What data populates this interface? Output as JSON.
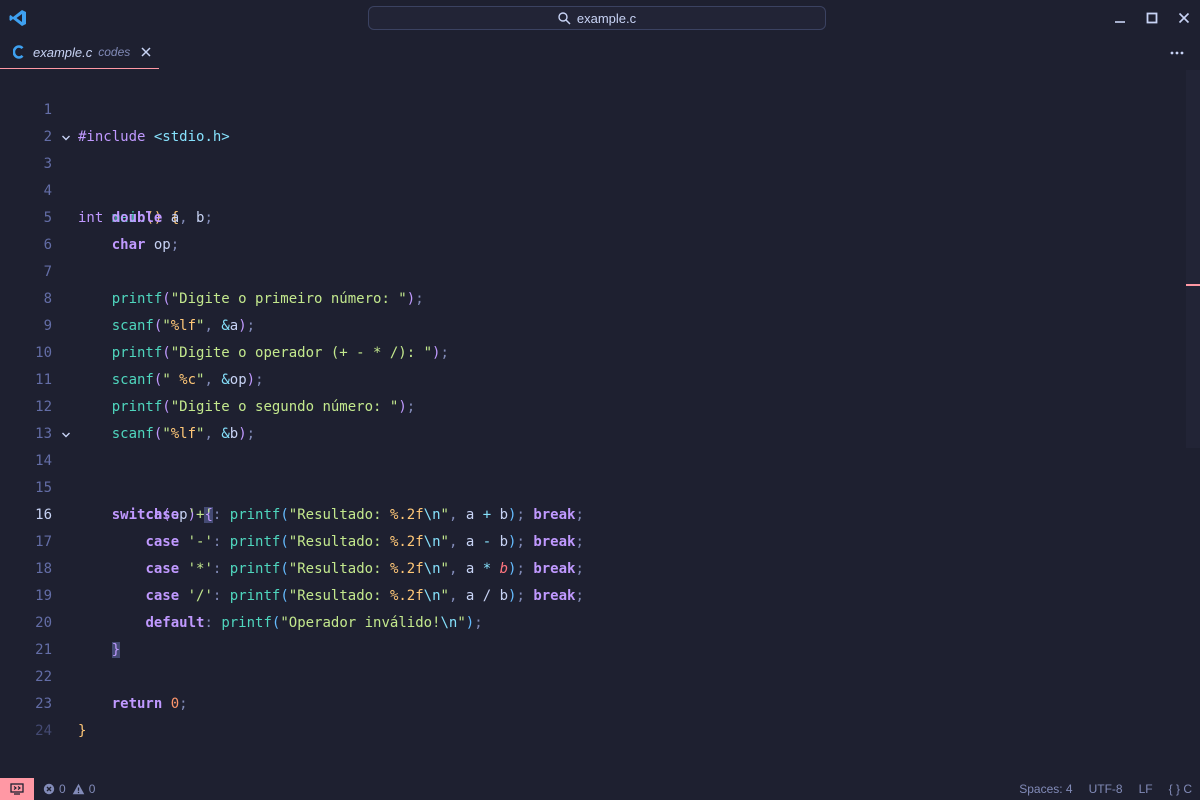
{
  "window": {
    "search_text": "example.c"
  },
  "tab": {
    "name": "example.c",
    "description": "codes"
  },
  "editor": {
    "active_line": 16,
    "line_numbers": [
      "1",
      "2",
      "3",
      "4",
      "5",
      "6",
      "7",
      "8",
      "9",
      "10",
      "11",
      "12",
      "13",
      "14",
      "15",
      "16",
      "17",
      "18",
      "19",
      "20",
      "21",
      "22",
      "23",
      "24"
    ]
  },
  "status": {
    "errors": "0",
    "warnings": "0",
    "indentation": "Spaces: 4",
    "encoding": "UTF-8",
    "eol": "LF",
    "language": "C"
  },
  "colors": {
    "accent": "#ff98a4",
    "background": "#1e2030"
  }
}
